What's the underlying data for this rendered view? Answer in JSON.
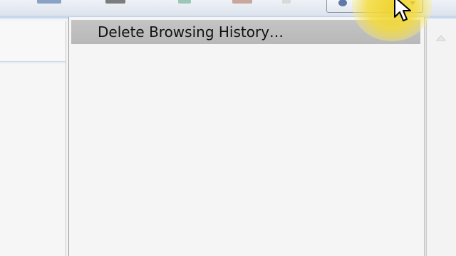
{
  "toolbar": {
    "icons": [
      "feeds-icon",
      "print-icon",
      "page-icon",
      "safety-icon",
      "help-icon"
    ],
    "tools_button": "tools-button"
  },
  "menu": {
    "items": [
      {
        "label": "Delete Browsing History…",
        "highlighted": true
      }
    ]
  },
  "colors": {
    "menu_highlight": "#bfbfbf",
    "menu_background": "#f5f5f5",
    "cursor_halo": "#f0d228"
  }
}
